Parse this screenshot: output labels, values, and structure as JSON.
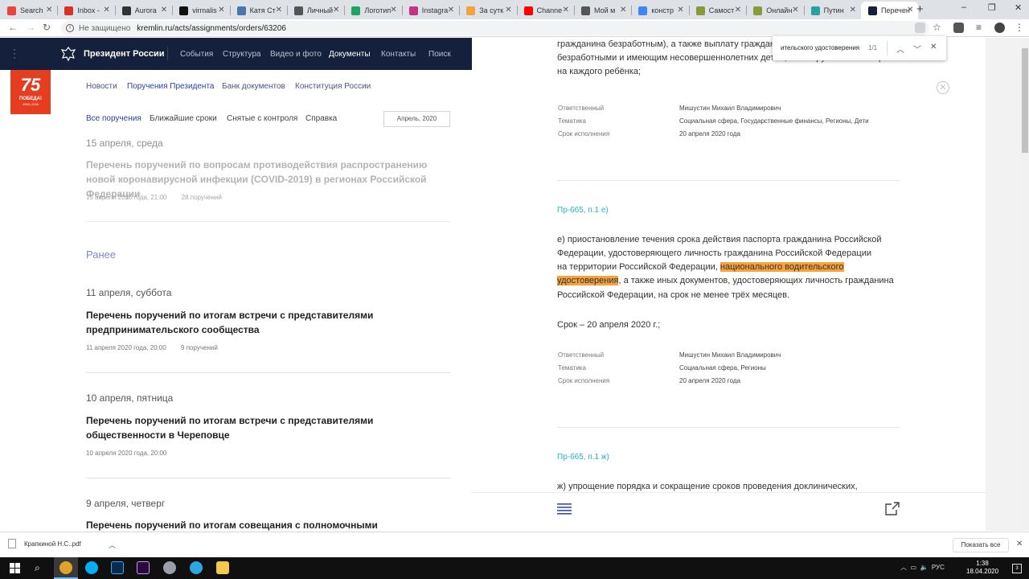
{
  "browser": {
    "tabs": [
      {
        "label": "Search",
        "color": "#e8453c"
      },
      {
        "label": "Inbox -",
        "color": "#d93025"
      },
      {
        "label": "Aurora",
        "color": "#333333"
      },
      {
        "label": "virmalis",
        "color": "#111111"
      },
      {
        "label": "Катя Ст",
        "color": "#4a76a8"
      },
      {
        "label": "Личный",
        "color": "#555555"
      },
      {
        "label": "Логотип",
        "color": "#1fa463"
      },
      {
        "label": "Instagra",
        "color": "#c13584"
      },
      {
        "label": "За сутк",
        "color": "#f4a23b"
      },
      {
        "label": "Channe",
        "color": "#ff0000"
      },
      {
        "label": "Мой м",
        "color": "#555555"
      },
      {
        "label": "констр",
        "color": "#4285f4"
      },
      {
        "label": "Самост",
        "color": "#8a9a3a"
      },
      {
        "label": "Онлайн",
        "color": "#8a9a3a"
      },
      {
        "label": "Путин",
        "color": "#2aa0a0"
      },
      {
        "label": "Перечен",
        "color": "#14203c"
      }
    ],
    "new_tab": "+",
    "window_minimize": "–",
    "window_restore": "❐",
    "window_close": "✕",
    "address": {
      "security": "Не защищено",
      "url": "kremlin.ru/acts/assignments/orders/63206"
    }
  },
  "site": {
    "name": "Президент России",
    "nav": [
      "События",
      "Структура",
      "Видео и фото",
      "Документы",
      "Контакты",
      "Поиск"
    ],
    "active_nav": "Документы",
    "badge": {
      "number": "75",
      "word": "ПОБЕДА!",
      "years": "1945–2020"
    },
    "subnav": [
      "Новости",
      "Поручения Президента",
      "Банк документов",
      "Конституция России"
    ],
    "filters": [
      "Все поручения",
      "Ближайшие сроки",
      "Снятые с контроля",
      "Справка"
    ],
    "date_filter": "Апрель, 2020",
    "earlier_label": "Ранее",
    "entries": [
      {
        "day": "15 апреля, среда",
        "title": "Перечень поручений по вопросам противодействия распространению новой коронавирусной инфекции (COVID-2019) в регионах Российской Федерации",
        "date": "15 апреля 2020 года, 21:00",
        "count": "28 поручений"
      },
      {
        "day": "11 апреля, суббота",
        "title": "Перечень поручений по итогам встречи с представителями предпринимательского сообщества",
        "date": "11 апреля 2020 года, 20:00",
        "count": "9 поручений"
      },
      {
        "day": "10 апреля, пятница",
        "title": "Перечень поручений по итогам встречи с представителями общественности в Череповце",
        "date": "10 апреля 2020 года, 20:00",
        "count": ""
      },
      {
        "day": "9 апреля, четверг",
        "title": "Перечень поручений по итогам совещания с полномочными представителями",
        "date": "",
        "count": ""
      }
    ]
  },
  "panel": {
    "top_text_1": "гражданина безработным), а также выплату гражданам, признанным",
    "top_text_2": "безработными и имеющим несовершеннолетних детей, 3 тыс. рублей в месяц",
    "top_text_3": "на каждого ребёнка;",
    "labels": {
      "responsible": "Ответственный",
      "topic": "Тематика",
      "deadline": "Срок исполнения"
    },
    "block1": {
      "responsible": "Мишустин Михаил Владимирович",
      "topic": "Социальная сфера, Государственные финансы, Регионы, Дети",
      "deadline": "20 апреля 2020 года"
    },
    "item_e": {
      "code": "Пр-665, п.1 е)",
      "line1": "е) приостановление течения срока действия паспорта гражданина Российской",
      "line2": "Федерации, удостоверяющего личность гражданина Российской Федерации",
      "line3_before": "на территории Российской Федерации, ",
      "highlight_1": "национального водительского",
      "highlight_2": "удостоверения",
      "line4_after": ", а также иных документов, удостоверяющих личность гражданина",
      "line5": "Российской Федерации, на срок не менее трёх месяцев.",
      "term": "Срок – 20 апреля 2020 г.;"
    },
    "block2": {
      "responsible": "Мишустин Михаил Владимирович",
      "topic": "Социальная сфера, Регионы",
      "deadline": "20 апреля 2020 года"
    },
    "item_zh": {
      "code": "Пр-665, п.1 ж)",
      "line1": "ж) упрощение порядка и сокращение сроков проведения доклинических,"
    }
  },
  "find": {
    "query": "ительского удостоверения",
    "count": "1/1"
  },
  "download": {
    "file": "Крапкиной Н.С..pdf",
    "show_all": "Показать все"
  },
  "taskbar": {
    "lang": "РУС",
    "time": "1:38",
    "date": "18.04.2020",
    "notifications": "3"
  }
}
